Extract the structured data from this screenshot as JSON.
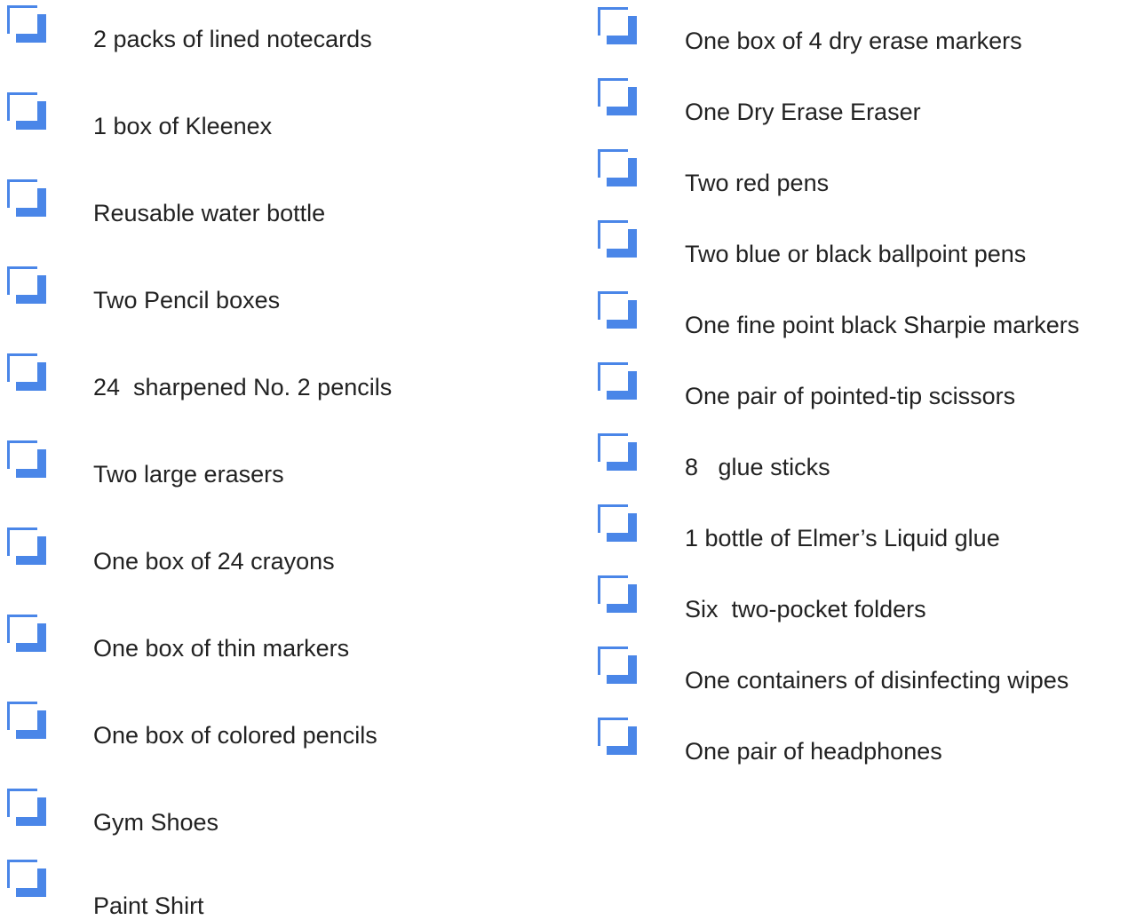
{
  "checkbox_color": "#4a86e8",
  "checkbox_icon": "empty-checkbox-icon",
  "left_items": [
    {
      "label": "2 packs of lined notecards",
      "checked": false
    },
    {
      "label": "1 box of Kleenex",
      "checked": false
    },
    {
      "label": "Reusable water bottle",
      "checked": false
    },
    {
      "label": "Two Pencil boxes",
      "checked": false
    },
    {
      "label": "24  sharpened No. 2 pencils",
      "checked": false
    },
    {
      "label": "Two large erasers",
      "checked": false
    },
    {
      "label": "One box of 24 crayons",
      "checked": false
    },
    {
      "label": "One box of thin markers",
      "checked": false
    },
    {
      "label": "One box of colored pencils",
      "checked": false
    },
    {
      "label": "Gym Shoes",
      "checked": false
    },
    {
      "label": "Paint Shirt",
      "checked": false
    }
  ],
  "right_items": [
    {
      "label": "One box of 4 dry erase markers",
      "checked": false
    },
    {
      "label": "One Dry Erase Eraser",
      "checked": false
    },
    {
      "label": "Two red pens",
      "checked": false
    },
    {
      "label": "Two blue or black ballpoint pens",
      "checked": false
    },
    {
      "label": "One fine point black Sharpie markers",
      "checked": false
    },
    {
      "label": "One pair of pointed-tip scissors",
      "checked": false
    },
    {
      "label": "8   glue sticks",
      "checked": false
    },
    {
      "label": "1 bottle of Elmer’s Liquid glue",
      "checked": false
    },
    {
      "label": "Six  two-pocket folders",
      "checked": false
    },
    {
      "label": "One containers of disinfecting wipes",
      "checked": false
    },
    {
      "label": "One pair of headphones",
      "checked": false
    }
  ]
}
